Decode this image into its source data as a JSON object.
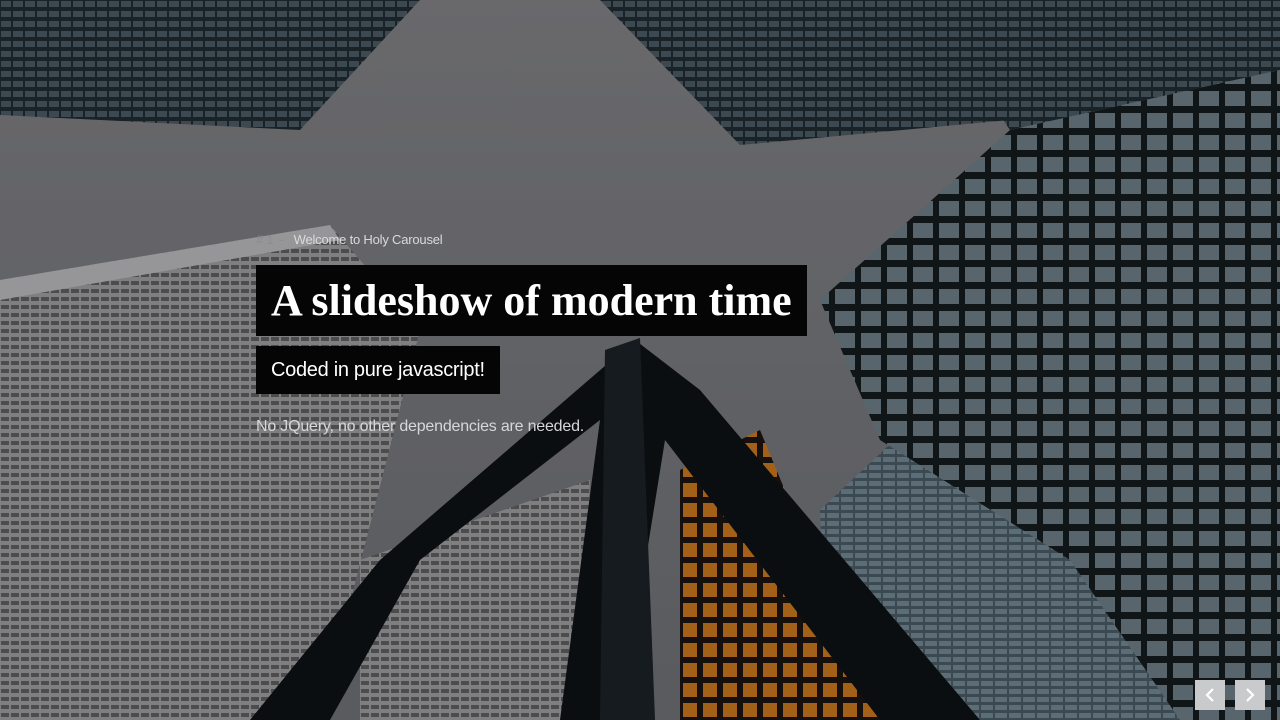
{
  "slide": {
    "number": "# 1",
    "separator": "-",
    "label": "Welcome to Holy Carousel",
    "title": "A slideshow of modern time",
    "subtitle": "Coded in pure javascript!",
    "description": "No JQuery, no other dependencies are needed."
  },
  "navigation": {
    "prev_icon": "chevron-left-icon",
    "next_icon": "chevron-right-icon"
  },
  "colors": {
    "sky": "#7d7e82",
    "title_bg": "#050505",
    "title_text": "#ffffff",
    "nav_button": "#c9cacc"
  }
}
